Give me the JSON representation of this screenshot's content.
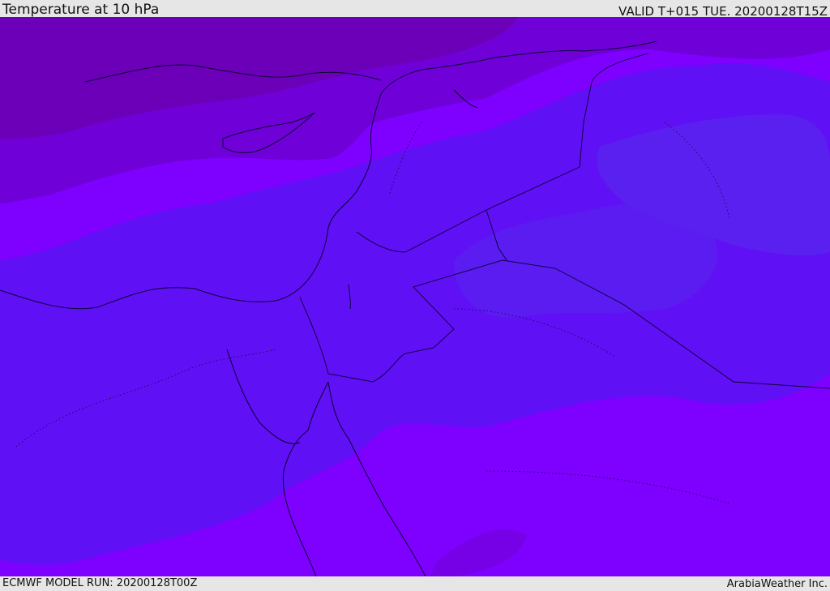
{
  "header": {
    "title": "Temperature at 10 hPa",
    "valid": "VALID T+015 TUE. 20200128T15Z"
  },
  "footer": {
    "model_run": "ECMWF MODEL RUN: 20200128T00Z",
    "credit": "ArabiaWeather Inc."
  },
  "colors": {
    "violet_base": "#7e00ff",
    "violet_cool": "#6010f4",
    "violet_dark": "#7000d8",
    "purple_deep": "#6c00b8",
    "coast": "#0a0033"
  }
}
